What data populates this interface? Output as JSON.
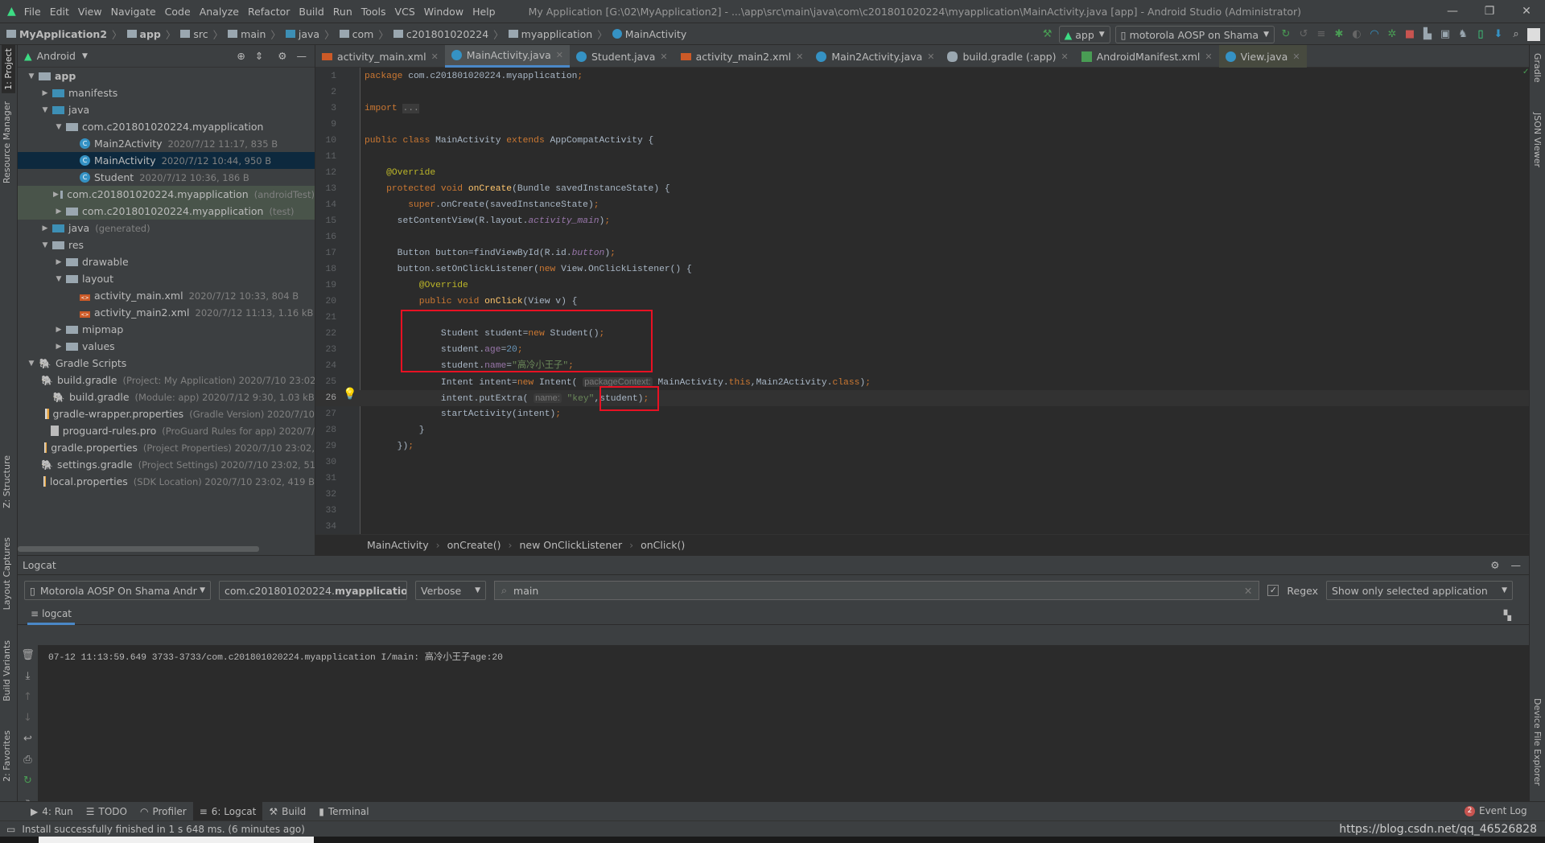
{
  "menu": {
    "items": [
      "File",
      "Edit",
      "View",
      "Navigate",
      "Code",
      "Analyze",
      "Refactor",
      "Build",
      "Run",
      "Tools",
      "VCS",
      "Window",
      "Help"
    ],
    "window_title": "My Application [G:\\02\\MyApplication2] - ...\\app\\src\\main\\java\\com\\c201801020224\\myapplication\\MainActivity.java [app] - Android Studio (Administrator)"
  },
  "nav": {
    "crumbs": [
      "MyApplication2",
      "app",
      "src",
      "main",
      "java",
      "com",
      "c201801020224",
      "myapplication",
      "MainActivity"
    ],
    "run_config": "app",
    "device": "motorola AOSP on Shama"
  },
  "project": {
    "view": "Android",
    "rows": [
      {
        "level": 0,
        "arrow": "open",
        "icon": "folder",
        "name": "app",
        "bold": true
      },
      {
        "level": 1,
        "arrow": "closed",
        "icon": "blue",
        "name": "manifests"
      },
      {
        "level": 1,
        "arrow": "open",
        "icon": "blue",
        "name": "java"
      },
      {
        "level": 2,
        "arrow": "open",
        "icon": "folder",
        "name": "com.c201801020224.myapplication"
      },
      {
        "level": 3,
        "icon": "class",
        "name": "Main2Activity",
        "meta": "2020/7/12 11:17, 835 B"
      },
      {
        "level": 3,
        "icon": "class",
        "name": "MainActivity",
        "meta": "2020/7/12 10:44, 950 B",
        "selected": true
      },
      {
        "level": 3,
        "icon": "class",
        "name": "Student",
        "meta": "2020/7/12 10:36, 186 B"
      },
      {
        "level": 2,
        "arrow": "closed",
        "icon": "folder",
        "name": "com.c201801020224.myapplication",
        "meta": "(androidTest)",
        "test": true
      },
      {
        "level": 2,
        "arrow": "closed",
        "icon": "folder",
        "name": "com.c201801020224.myapplication",
        "meta": "(test)",
        "test": true
      },
      {
        "level": 1,
        "arrow": "closed",
        "icon": "blue",
        "name": "java",
        "meta": "(generated)"
      },
      {
        "level": 1,
        "arrow": "open",
        "icon": "folder",
        "name": "res"
      },
      {
        "level": 2,
        "arrow": "closed",
        "icon": "folder",
        "name": "drawable"
      },
      {
        "level": 2,
        "arrow": "open",
        "icon": "folder",
        "name": "layout"
      },
      {
        "level": 3,
        "icon": "xml",
        "name": "activity_main.xml",
        "meta": "2020/7/12 10:33, 804 B"
      },
      {
        "level": 3,
        "icon": "xml",
        "name": "activity_main2.xml",
        "meta": "2020/7/12 11:13, 1.16 kB"
      },
      {
        "level": 2,
        "arrow": "closed",
        "icon": "folder",
        "name": "mipmap"
      },
      {
        "level": 2,
        "arrow": "closed",
        "icon": "folder",
        "name": "values"
      },
      {
        "level": 0,
        "arrow": "open",
        "icon": "gradle",
        "name": "Gradle Scripts"
      },
      {
        "level": 1,
        "icon": "gradle",
        "name": "build.gradle",
        "meta": "(Project: My Application)  2020/7/10 23:02,"
      },
      {
        "level": 1,
        "icon": "gradle",
        "name": "build.gradle",
        "meta": "(Module: app)  2020/7/12 9:30, 1.03 kB"
      },
      {
        "level": 1,
        "icon": "prop",
        "name": "gradle-wrapper.properties",
        "meta": "(Gradle Version)  2020/7/10"
      },
      {
        "level": 1,
        "icon": "file",
        "name": "proguard-rules.pro",
        "meta": "(ProGuard Rules for app)  2020/7/"
      },
      {
        "level": 1,
        "icon": "prop",
        "name": "gradle.properties",
        "meta": "(Project Properties)  2020/7/10 23:02,"
      },
      {
        "level": 1,
        "icon": "gradle",
        "name": "settings.gradle",
        "meta": "(Project Settings)  2020/7/10 23:02, 51 B"
      },
      {
        "level": 1,
        "icon": "prop",
        "name": "local.properties",
        "meta": "(SDK Location)  2020/7/10 23:02, 419 B"
      }
    ]
  },
  "tabs": [
    {
      "label": "activity_main.xml",
      "icon": "xml"
    },
    {
      "label": "MainActivity.java",
      "icon": "class",
      "active": true
    },
    {
      "label": "Student.java",
      "icon": "class"
    },
    {
      "label": "activity_main2.xml",
      "icon": "xml"
    },
    {
      "label": "Main2Activity.java",
      "icon": "class"
    },
    {
      "label": "build.gradle (:app)",
      "icon": "gradle"
    },
    {
      "label": "AndroidManifest.xml",
      "icon": "mf"
    },
    {
      "label": "View.java",
      "icon": "class",
      "last": true
    }
  ],
  "code": [
    {
      "n": "1",
      "t": [
        [
          "kw",
          "package "
        ],
        [
          "",
          "com.c201801020224.myapplication"
        ],
        [
          "kw",
          ";"
        ]
      ]
    },
    {
      "n": "2",
      "t": []
    },
    {
      "n": "3",
      "t": [
        [
          "kw",
          "import "
        ],
        [
          "fold",
          "..."
        ]
      ]
    },
    {
      "n": "9",
      "t": []
    },
    {
      "n": "10",
      "t": [
        [
          "kw",
          "public class "
        ],
        [
          "",
          "MainActivity "
        ],
        [
          "kw",
          "extends "
        ],
        [
          "",
          "AppCompatActivity {"
        ]
      ]
    },
    {
      "n": "11",
      "t": []
    },
    {
      "n": "12",
      "t": [
        [
          "",
          "    "
        ],
        [
          "an",
          "@Override"
        ]
      ]
    },
    {
      "n": "13",
      "t": [
        [
          "",
          "    "
        ],
        [
          "kw",
          "protected void "
        ],
        [
          "fn",
          "onCreate"
        ],
        [
          "",
          "(Bundle savedInstanceState) {"
        ]
      ]
    },
    {
      "n": "14",
      "t": [
        [
          "",
          "        "
        ],
        [
          "kw",
          "super"
        ],
        [
          "",
          ".onCreate(savedInstanceState)"
        ],
        [
          "kw",
          ";"
        ]
      ]
    },
    {
      "n": "15",
      "t": [
        [
          "",
          "      setContentView(R.layout."
        ],
        [
          "it",
          "activity_main"
        ],
        [
          "",
          ")"
        ],
        [
          "kw",
          ";"
        ]
      ]
    },
    {
      "n": "16",
      "t": []
    },
    {
      "n": "17",
      "t": [
        [
          "",
          "      Button button=findViewById(R.id."
        ],
        [
          "it",
          "button"
        ],
        [
          "",
          ")"
        ],
        [
          "kw",
          ";"
        ]
      ]
    },
    {
      "n": "18",
      "t": [
        [
          "",
          "      button.setOnClickListener("
        ],
        [
          "kw",
          "new "
        ],
        [
          "",
          "View.OnClickListener() {"
        ]
      ]
    },
    {
      "n": "19",
      "t": [
        [
          "",
          "          "
        ],
        [
          "an",
          "@Override"
        ]
      ]
    },
    {
      "n": "20",
      "t": [
        [
          "",
          "          "
        ],
        [
          "kw",
          "public void "
        ],
        [
          "fn",
          "onClick"
        ],
        [
          "",
          "(View v) {"
        ]
      ]
    },
    {
      "n": "21",
      "t": []
    },
    {
      "n": "22",
      "t": [
        [
          "",
          "              Student student="
        ],
        [
          "kw",
          "new "
        ],
        [
          "",
          "Student()"
        ],
        [
          "kw",
          ";"
        ]
      ]
    },
    {
      "n": "23",
      "t": [
        [
          "",
          "              student."
        ],
        [
          "fld",
          "age"
        ],
        [
          "",
          "="
        ],
        [
          "num",
          "20"
        ],
        [
          "kw",
          ";"
        ]
      ]
    },
    {
      "n": "24",
      "t": [
        [
          "",
          "              student."
        ],
        [
          "fld",
          "name"
        ],
        [
          "",
          "="
        ],
        [
          "str",
          "\"高冷小王子\""
        ],
        [
          "kw",
          ";"
        ]
      ]
    },
    {
      "n": "25",
      "t": [
        [
          "",
          "              Intent intent="
        ],
        [
          "kw",
          "new "
        ],
        [
          "",
          "Intent( "
        ],
        [
          "hint",
          "packageContext:"
        ],
        [
          "",
          " MainActivity."
        ],
        [
          "kw",
          "this"
        ],
        [
          "",
          ",Main2Activity."
        ],
        [
          "kw",
          "class"
        ],
        [
          "",
          ")"
        ],
        [
          "kw",
          ";"
        ]
      ]
    },
    {
      "n": "26",
      "cur": true,
      "t": [
        [
          "",
          "              intent.putExtra( "
        ],
        [
          "hint",
          "name:"
        ],
        [
          "str",
          " \"key\""
        ],
        [
          "",
          ",student)"
        ],
        [
          "kw",
          ";"
        ]
      ]
    },
    {
      "n": "27",
      "t": [
        [
          "",
          "              startActivity(intent)"
        ],
        [
          "kw",
          ";"
        ]
      ]
    },
    {
      "n": "28",
      "t": [
        [
          "",
          "          }"
        ]
      ]
    },
    {
      "n": "29",
      "t": [
        [
          "",
          "      })"
        ],
        [
          "kw",
          ";"
        ]
      ]
    },
    {
      "n": "30",
      "t": []
    },
    {
      "n": "31",
      "t": []
    },
    {
      "n": "32",
      "t": []
    },
    {
      "n": "33",
      "t": []
    },
    {
      "n": "34",
      "t": []
    }
  ],
  "editor_crumbs": [
    "MainActivity",
    "onCreate()",
    "new OnClickListener",
    "onClick()"
  ],
  "logcat": {
    "title": "Logcat",
    "device": "Motorola AOSP On Shama Andr",
    "process": "com.c201801020224.",
    "process_bold": "myapplicatio",
    "level": "Verbose",
    "search": "main",
    "regex_label": "Regex",
    "regex_checked": true,
    "filter": "Show only selected application",
    "tab": "logcat",
    "line": "07-12 11:13:59.649 3733-3733/com.c201801020224.myapplication I/main: 高冷小王子age:20"
  },
  "bottom_tabs": [
    {
      "label": "4: Run"
    },
    {
      "label": "TODO"
    },
    {
      "label": "Profiler"
    },
    {
      "label": "6: Logcat",
      "active": true
    },
    {
      "label": "Build"
    },
    {
      "label": "Terminal"
    }
  ],
  "event_log": {
    "count": "2",
    "label": "Event Log"
  },
  "status": "Install successfully finished in 1 s 648 ms. (6 minutes ago)",
  "watermark": "https://blog.csdn.net/qq_46526828",
  "left_strip": [
    "1: Project",
    "Resource Manager",
    "Z: Structure",
    "Layout Captures",
    "Build Variants",
    "2: Favorites"
  ],
  "right_strip": [
    "Gradle",
    "JSON Viewer",
    "Device File Explorer"
  ],
  "colors": {
    "highlight_box": "#e81123",
    "accent": "#4a88c7",
    "selection": "#0d293e"
  }
}
